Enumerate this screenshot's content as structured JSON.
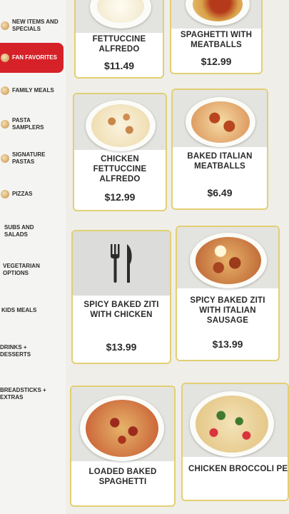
{
  "sidebar": {
    "items": [
      {
        "label": "NEW ITEMS AND SPECIALS",
        "active": false
      },
      {
        "label": "FAN FAVORITES",
        "active": true
      },
      {
        "label": "FAMILY MEALS",
        "active": false
      },
      {
        "label": "PASTA SAMPLERS",
        "active": false
      },
      {
        "label": "SIGNATURE PASTAS",
        "active": false
      },
      {
        "label": "PIZZAS",
        "active": false
      },
      {
        "label": "SUBS AND SALADS",
        "active": false
      },
      {
        "label": "VEGETARIAN OPTIONS",
        "active": false
      },
      {
        "label": "KIDS MEALS",
        "active": false
      },
      {
        "label": "DRINKS + DESSERTS",
        "active": false
      },
      {
        "label": "BREADSTICKS + EXTRAS",
        "active": false
      }
    ]
  },
  "menu": {
    "items": [
      {
        "name": "FETTUCCINE ALFREDO",
        "price": "$11.49",
        "image": "fettuccine-alfredo-photo"
      },
      {
        "name": "SPAGHETTI WITH MEATBALLS",
        "price": "$12.99",
        "image": "spaghetti-meatballs-photo"
      },
      {
        "name": "CHICKEN FETTUCCINE ALFREDO",
        "price": "$12.99",
        "image": "chicken-fettuccine-photo"
      },
      {
        "name": "BAKED ITALIAN MEATBALLS",
        "price": "$6.49",
        "image": "baked-meatballs-photo"
      },
      {
        "name": "SPICY BAKED ZITI WITH CHICKEN",
        "price": "$13.99",
        "image": "fork-knife-icon"
      },
      {
        "name": "SPICY BAKED ZITI WITH ITALIAN SAUSAGE",
        "price": "$13.99",
        "image": "baked-ziti-sausage-photo"
      },
      {
        "name": "LOADED BAKED SPAGHETTI",
        "price": "",
        "image": "loaded-spaghetti-photo"
      },
      {
        "name": "CHICKEN BROCCOLI PENNE",
        "price": "",
        "image": "broccoli-penne-photo"
      }
    ]
  },
  "colors": {
    "accent": "#d62128",
    "card_border": "#e3cf73"
  }
}
